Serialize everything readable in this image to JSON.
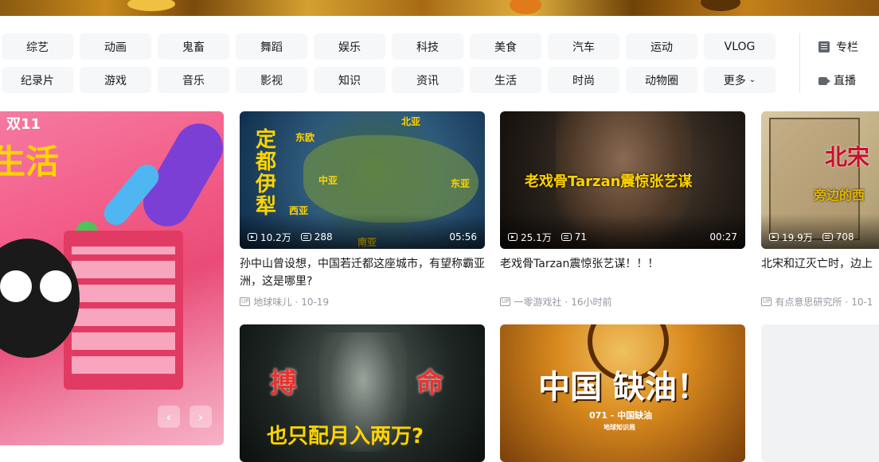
{
  "categories": {
    "row1": [
      "综艺",
      "动画",
      "鬼畜",
      "舞蹈",
      "娱乐",
      "科技",
      "美食",
      "汽车",
      "运动",
      "VLOG"
    ],
    "row2": [
      "纪录片",
      "游戏",
      "音乐",
      "影视",
      "知识",
      "资讯",
      "生活",
      "时尚",
      "动物圈",
      "更多"
    ]
  },
  "side_links": {
    "column": "专栏",
    "live": "直播"
  },
  "carousel": {
    "overlay_text_1": "双11",
    "overlay_text_2": "生活"
  },
  "videos": [
    {
      "title": "孙中山曾设想，中国若迁都这座城市，有望称霸亚洲，这是哪里?",
      "views": "10.2万",
      "danmaku": "288",
      "duration": "05:56",
      "uploader": "地球味儿",
      "date": "10-19",
      "overlay": {
        "vertical": "定都伊犁",
        "labels": [
          "东欧",
          "北亚",
          "中亚",
          "东亚",
          "西亚",
          "南亚"
        ]
      }
    },
    {
      "title": "老戏骨Tarzan震惊张艺谋！！！",
      "views": "25.1万",
      "danmaku": "71",
      "duration": "00:27",
      "uploader": "一零游戏社",
      "date": "16小时前",
      "overlay": {
        "caption": "老戏骨Tarzan震惊张艺谋"
      }
    },
    {
      "title": "北宋和辽灭亡时，边上",
      "views": "19.9万",
      "danmaku": "708",
      "duration": "",
      "uploader": "有点意思研究所",
      "date": "10-1",
      "overlay": {
        "big": "北宋",
        "sub": "旁边的西"
      }
    },
    {
      "title": "",
      "overlay": {
        "left": "搏",
        "right": "命",
        "bottom": "也只配月入两万?"
      }
    },
    {
      "title": "",
      "overlay": {
        "big": "中国 缺油！",
        "small": "071 - 中国缺油",
        "tiny": "地球知识局"
      }
    }
  ],
  "up_label": "UP",
  "more_chevron": "⌄"
}
